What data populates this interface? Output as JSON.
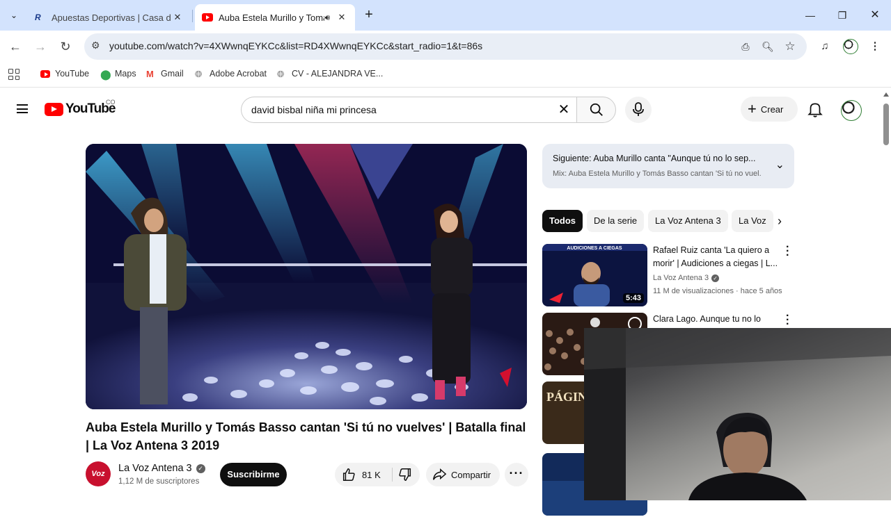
{
  "browser": {
    "tabs": [
      {
        "title": "Apuestas Deportivas | Casa de A",
        "active": false
      },
      {
        "title": "Auba Estela Murillo y Tomás",
        "active": true
      }
    ],
    "url": "youtube.com/watch?v=4XWwnqEYKCc&list=RD4XWwnqEYKCc&start_radio=1&t=86s",
    "bookmarks": [
      "YouTube",
      "Maps",
      "Gmail",
      "Adobe Acrobat",
      "CV - ALEJANDRA VE..."
    ]
  },
  "youtube": {
    "logo_text": "YouTube",
    "country": "CO",
    "search_query": "david bisbal niña mi princesa",
    "create_label": "Crear"
  },
  "video": {
    "title": "Auba Estela Murillo y Tomás Basso cantan 'Si tú no vuelves' | Batalla final | La Voz Antena 3 2019",
    "channel": "La Voz Antena 3",
    "subscribers": "1,12 M de suscriptores",
    "subscribe_label": "Suscribirme",
    "likes": "81 K",
    "share_label": "Compartir",
    "avatar_text": "Voz"
  },
  "sidebar": {
    "next_label": "Siguiente:",
    "next_title": "Auba Murillo canta \"Aunque tú no lo sep...",
    "next_sub": "Mix: Auba Estela Murillo y Tomás Basso cantan 'Si tú no vuel...",
    "chips": [
      "Todos",
      "De la serie",
      "La Voz Antena 3",
      "La Voz"
    ],
    "recommendations": [
      {
        "title": "Rafael Ruiz canta 'La quiero a morir' | Audiciones a ciegas | L...",
        "channel": "La Voz Antena 3",
        "meta": "11 M de visualizaciones · hace 5 años",
        "duration": "5:43",
        "thumb_label": "AUDICIONES A CIEGAS"
      },
      {
        "title": "Clara Lago.  Aunque tu no lo",
        "channel": "",
        "meta": "",
        "duration": ""
      },
      {
        "title": "",
        "channel": "",
        "meta": "",
        "duration": "",
        "thumb_label": "PÁGINA EN BLANCO"
      },
      {
        "title": "",
        "channel": "",
        "meta": "",
        "duration": ""
      }
    ]
  },
  "colors": {
    "brand_red": "#ff0000",
    "chrome_tabstrip": "#d3e3fd",
    "text": "#0f0f0f"
  }
}
